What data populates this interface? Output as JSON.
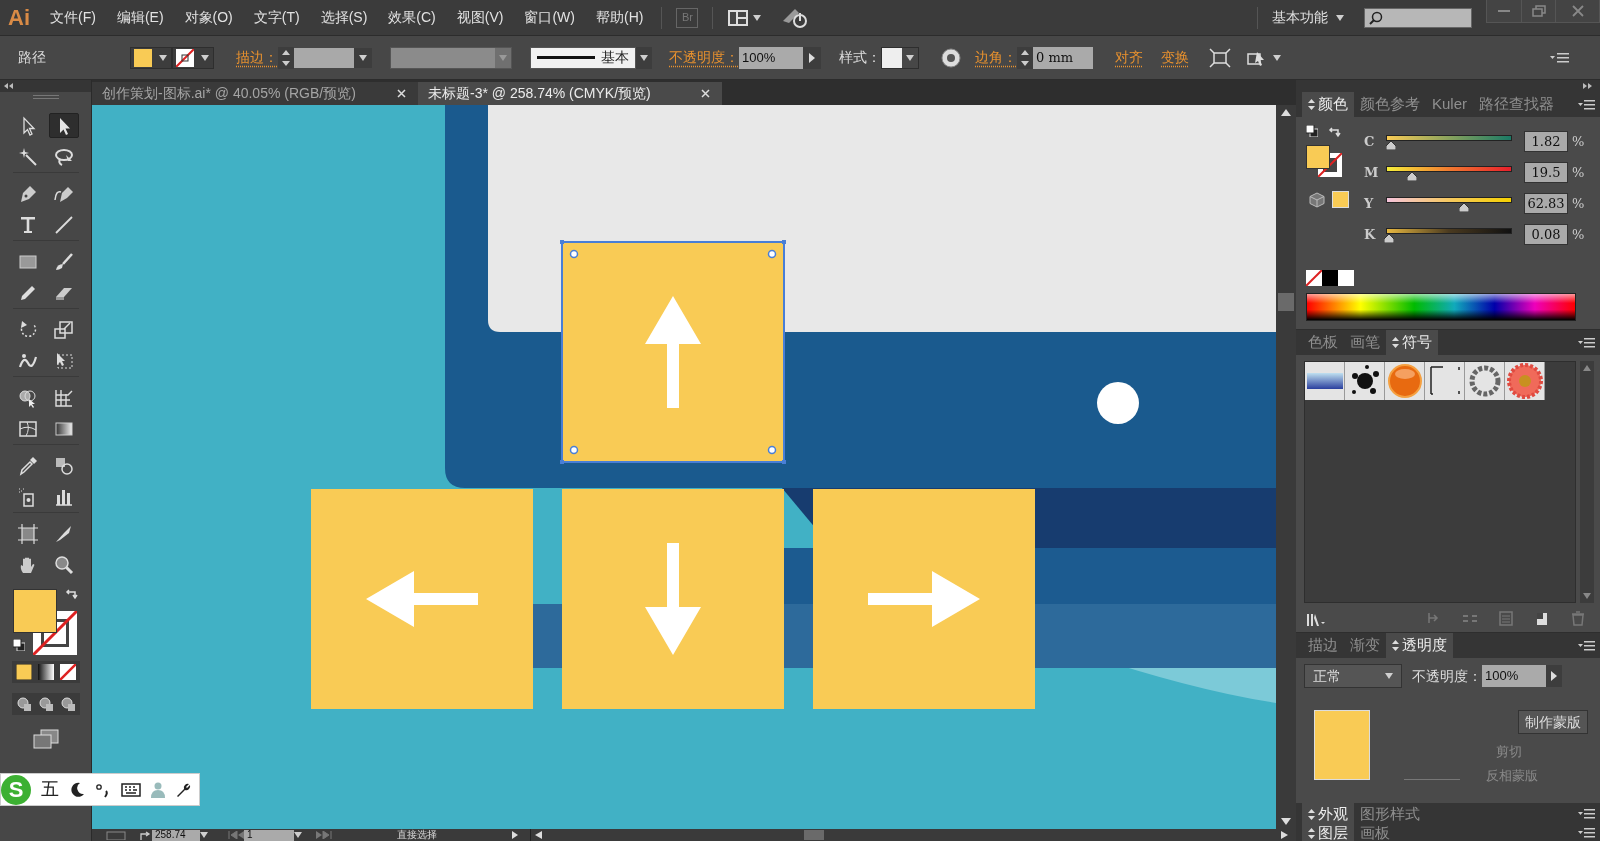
{
  "menu_bar": {
    "logo": "Ai",
    "items": [
      "文件(F)",
      "编辑(E)",
      "对象(O)",
      "文字(T)",
      "选择(S)",
      "效果(C)",
      "视图(V)",
      "窗口(W)",
      "帮助(H)"
    ],
    "bridge": "Br",
    "workspace": "基本功能"
  },
  "control_bar": {
    "selection": "路径",
    "stroke_label": "描边：",
    "stroke_profile": "基本",
    "opacity_label": "不透明度：",
    "opacity": "100%",
    "style_label": "样式：",
    "corner_label": "边角：",
    "corner": "0 mm",
    "align": "对齐",
    "transform": "变换"
  },
  "document_tabs": [
    {
      "label": "创作策划-图标.ai* @ 40.05% (RGB/预览)",
      "selected": false
    },
    {
      "label": "未标题-3* @ 258.74% (CMYK/预览)",
      "selected": true
    }
  ],
  "tools": [
    {
      "kind": "selection",
      "selected": false
    },
    {
      "kind": "direct",
      "selected": true
    },
    {
      "kind": "wand",
      "selected": false
    },
    {
      "kind": "lasso",
      "selected": false
    },
    {
      "kind": "pen",
      "selected": false
    },
    {
      "kind": "curvature",
      "selected": false
    },
    {
      "kind": "type",
      "selected": false
    },
    {
      "kind": "line",
      "selected": false
    },
    {
      "kind": "rect",
      "selected": false
    },
    {
      "kind": "brush",
      "selected": false
    },
    {
      "kind": "pencil",
      "selected": false
    },
    {
      "kind": "eraser",
      "selected": false
    },
    {
      "kind": "rotate",
      "selected": false
    },
    {
      "kind": "scale",
      "selected": false
    },
    {
      "kind": "warp",
      "selected": false
    },
    {
      "kind": "freetransform",
      "selected": false
    },
    {
      "kind": "shapebuilder",
      "selected": false
    },
    {
      "kind": "perspective",
      "selected": false
    },
    {
      "kind": "mesh",
      "selected": false
    },
    {
      "kind": "gradient",
      "selected": false
    },
    {
      "kind": "eyedropper",
      "selected": false
    },
    {
      "kind": "blend",
      "selected": false
    },
    {
      "kind": "sprayer",
      "selected": false
    },
    {
      "kind": "graph",
      "selected": false
    },
    {
      "kind": "artboard",
      "selected": false
    },
    {
      "kind": "slice",
      "selected": false
    },
    {
      "kind": "hand",
      "selected": false
    },
    {
      "kind": "zoom",
      "selected": false
    }
  ],
  "artboard": {
    "keys": [
      {
        "kind": "up",
        "selected": true
      },
      {
        "kind": "left",
        "selected": false
      },
      {
        "kind": "down",
        "selected": false
      },
      {
        "kind": "right",
        "selected": false
      }
    ]
  },
  "color_panel": {
    "tabs": [
      {
        "label": "颜色",
        "selected": true
      },
      {
        "label": "颜色参考",
        "selected": false
      },
      {
        "label": "Kuler",
        "selected": false
      },
      {
        "label": "路径查找器",
        "selected": false
      }
    ],
    "sliders": [
      {
        "channel": "C",
        "level": 0.02,
        "value": "1.82",
        "unit": "%"
      },
      {
        "channel": "M",
        "level": 0.195,
        "value": "19.5",
        "unit": "%"
      },
      {
        "channel": "Y",
        "level": 0.628,
        "value": "62.83",
        "unit": "%"
      },
      {
        "channel": "K",
        "level": 0.0,
        "value": "0.08",
        "unit": "%"
      }
    ]
  },
  "swatch_panel": {
    "tabs": [
      {
        "label": "色板",
        "selected": false
      },
      {
        "label": "画笔",
        "selected": false
      },
      {
        "label": "符号",
        "selected": true
      }
    ],
    "symbols": [
      {
        "kind": "banner"
      },
      {
        "kind": "splat"
      },
      {
        "kind": "orb"
      },
      {
        "kind": "marks"
      },
      {
        "kind": "ring"
      },
      {
        "kind": "flower"
      }
    ]
  },
  "transparency_panel": {
    "tabs": [
      {
        "label": "描边",
        "selected": false
      },
      {
        "label": "渐变",
        "selected": false
      },
      {
        "label": "透明度",
        "selected": true
      }
    ],
    "blend_mode": "正常",
    "opacity_label": "不透明度：",
    "opacity": "100%",
    "mask_button": "制作蒙版",
    "clip": "剪切",
    "invert": "反相蒙版"
  },
  "appearance_tabs": [
    {
      "label": "外观",
      "selected": true
    },
    {
      "label": "图形样式",
      "selected": false
    }
  ],
  "layers_tabs": [
    {
      "label": "图层",
      "selected": true
    },
    {
      "label": "画板",
      "selected": false
    }
  ],
  "status_bar": {
    "zoom": "258.74",
    "artboard": "1",
    "tool": "直接选择"
  },
  "ime_bar": {
    "logo": "S",
    "mode": "五"
  }
}
